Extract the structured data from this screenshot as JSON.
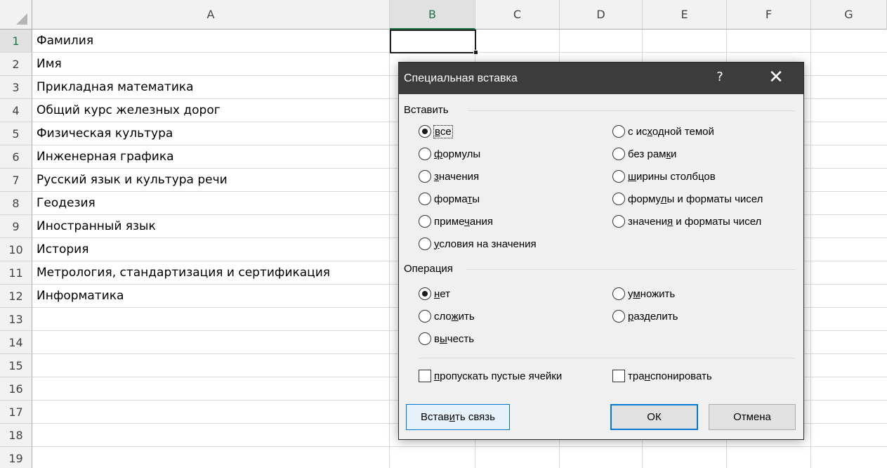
{
  "sheet": {
    "columns": [
      "A",
      "B",
      "C",
      "D",
      "E",
      "F",
      "G"
    ],
    "selected_column": "B",
    "rows": [
      {
        "num": "1",
        "a": "Фамилия"
      },
      {
        "num": "2",
        "a": "Имя"
      },
      {
        "num": "3",
        "a": "Прикладная математика"
      },
      {
        "num": "4",
        "a": "Общий курс железных дорог"
      },
      {
        "num": "5",
        "a": "Физическая культура"
      },
      {
        "num": "6",
        "a": "Инженерная графика"
      },
      {
        "num": "7",
        "a": "Русский язык и культура речи"
      },
      {
        "num": "8",
        "a": "Геодезия"
      },
      {
        "num": "9",
        "a": "Иностранный язык"
      },
      {
        "num": "10",
        "a": "История"
      },
      {
        "num": "11",
        "a": "Метрология, стандартизация и сертификация"
      },
      {
        "num": "12",
        "a": "Информатика"
      },
      {
        "num": "13",
        "a": ""
      },
      {
        "num": "14",
        "a": ""
      },
      {
        "num": "15",
        "a": ""
      },
      {
        "num": "16",
        "a": ""
      },
      {
        "num": "17",
        "a": ""
      },
      {
        "num": "18",
        "a": ""
      },
      {
        "num": "19",
        "a": ""
      }
    ],
    "accent_color": "#217346"
  },
  "dialog": {
    "title": "Специальная вставка",
    "help": "?",
    "close": "✕",
    "paste_group": {
      "title": "Вставить",
      "left": [
        {
          "pre": "",
          "u": "в",
          "post": "се",
          "checked": true
        },
        {
          "pre": "",
          "u": "ф",
          "post": "ормулы",
          "checked": false
        },
        {
          "pre": "",
          "u": "з",
          "post": "начения",
          "checked": false
        },
        {
          "pre": "форма",
          "u": "т",
          "post": "ы",
          "checked": false
        },
        {
          "pre": "приме",
          "u": "ч",
          "post": "ания",
          "checked": false
        },
        {
          "pre": "",
          "u": "у",
          "post": "словия на значения",
          "checked": false
        }
      ],
      "right": [
        {
          "pre": "с ис",
          "u": "х",
          "post": "одной темой",
          "checked": false
        },
        {
          "pre": "без рам",
          "u": "к",
          "post": "и",
          "checked": false
        },
        {
          "pre": "",
          "u": "ш",
          "post": "ирины столбцов",
          "checked": false
        },
        {
          "pre": "форму",
          "u": "л",
          "post": "ы и форматы чисел",
          "checked": false
        },
        {
          "pre": "значени",
          "u": "я",
          "post": " и форматы чисел",
          "checked": false
        }
      ]
    },
    "operation_group": {
      "title": "Операция",
      "left": [
        {
          "pre": "",
          "u": "н",
          "post": "ет",
          "checked": true
        },
        {
          "pre": "сло",
          "u": "ж",
          "post": "ить",
          "checked": false
        },
        {
          "pre": "в",
          "u": "ы",
          "post": "честь",
          "checked": false
        }
      ],
      "right": [
        {
          "pre": "у",
          "u": "м",
          "post": "ножить",
          "checked": false
        },
        {
          "pre": "",
          "u": "р",
          "post": "азделить",
          "checked": false
        }
      ]
    },
    "skip_blanks": {
      "pre": "",
      "u": "п",
      "post": "ропускать пустые ячейки",
      "checked": false
    },
    "transpose": {
      "pre": "тра",
      "u": "н",
      "post": "спонировать",
      "checked": false
    },
    "buttons": {
      "paste_link": {
        "pre": "Встав",
        "u": "и",
        "post": "ть связь"
      },
      "ok": "ОК",
      "cancel": "Отмена"
    },
    "focus_color": "#0078d7"
  }
}
